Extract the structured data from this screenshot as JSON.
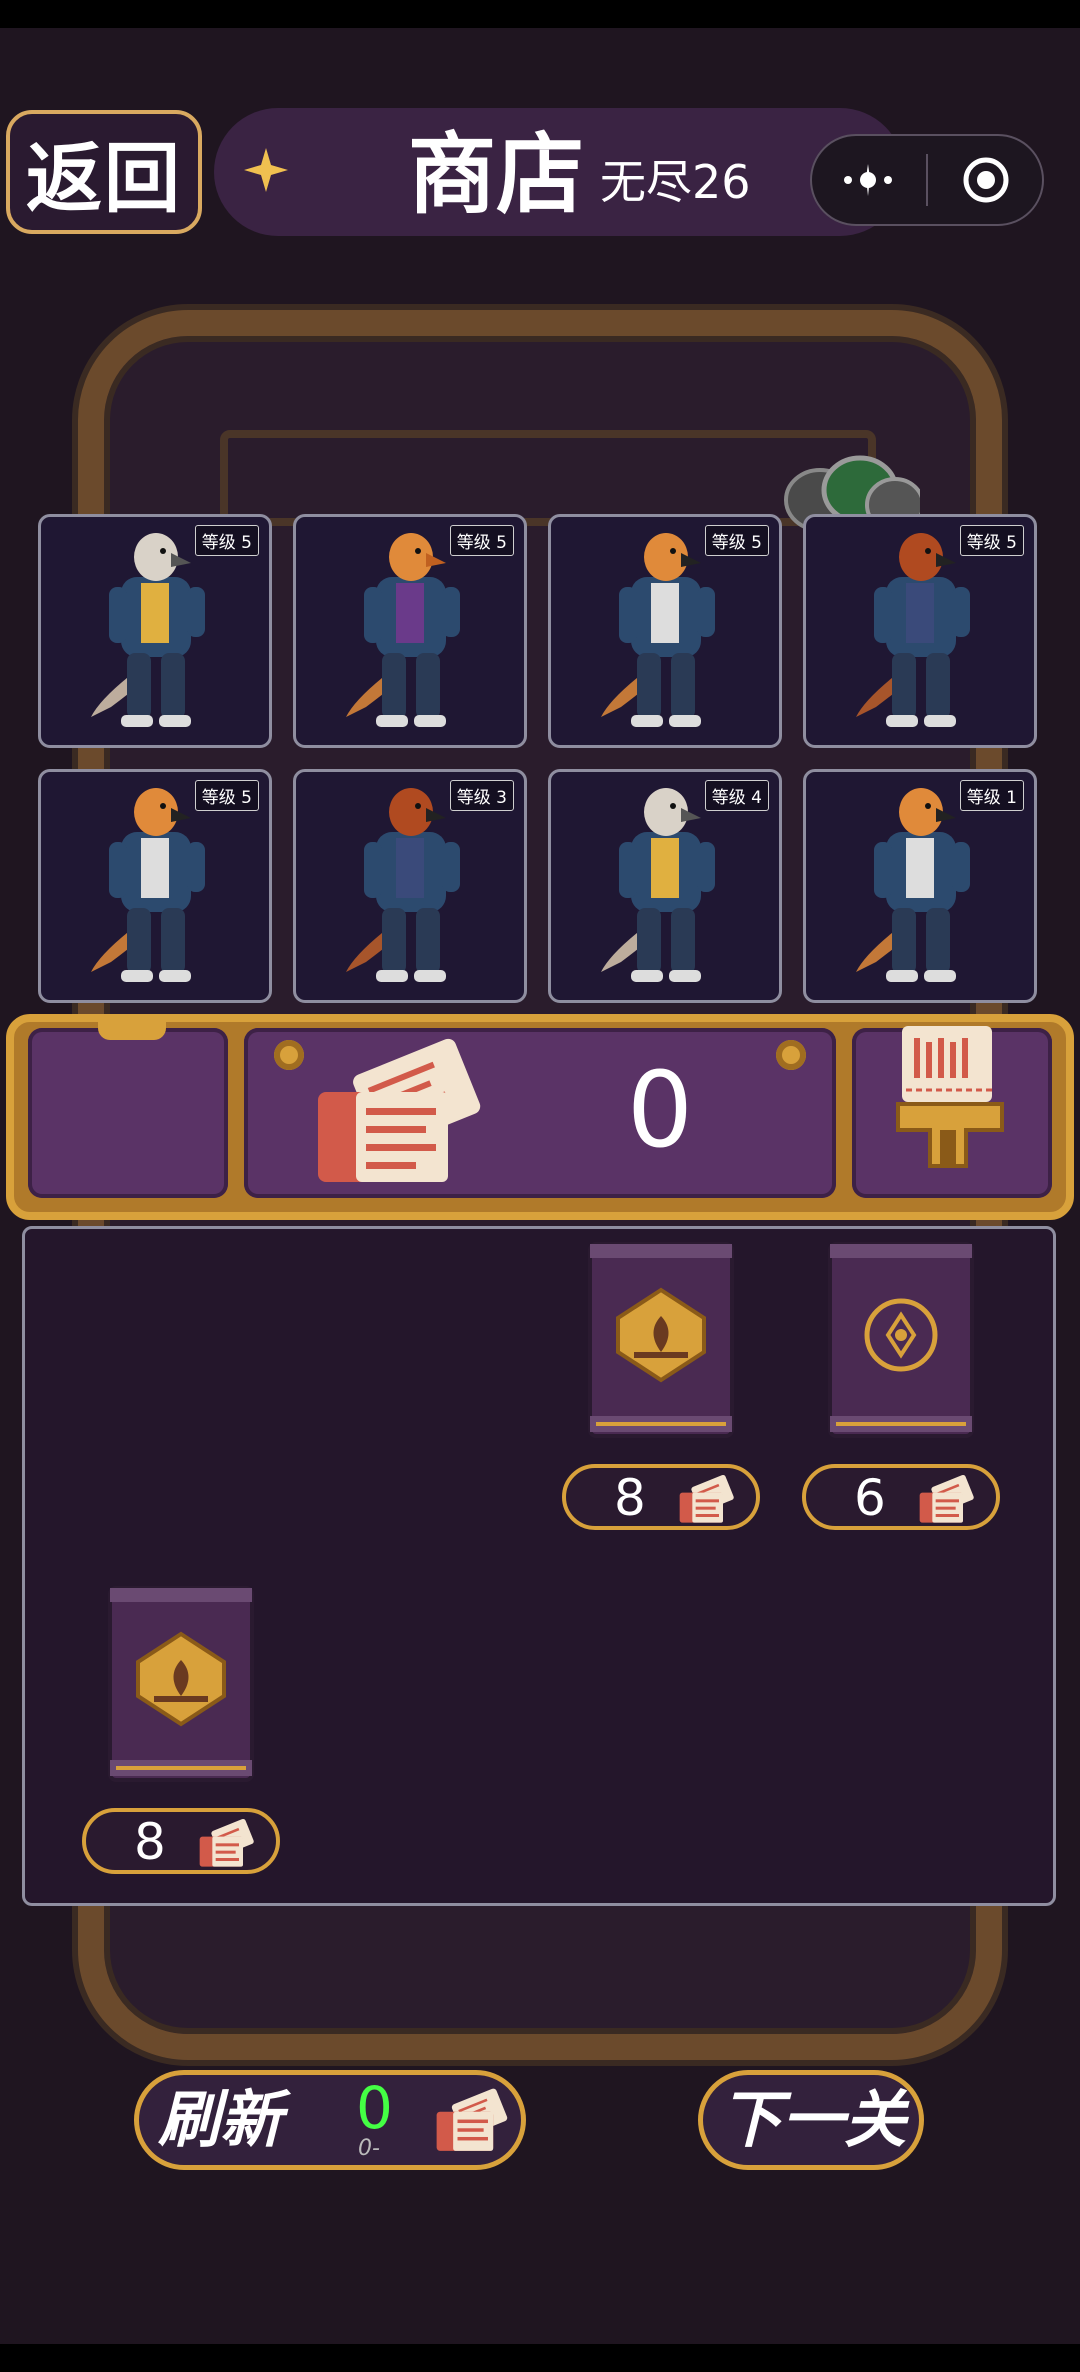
{
  "header": {
    "back_label": "返回",
    "title": "商店",
    "subtitle": "无尽26"
  },
  "team": [
    {
      "level": "等级 5",
      "character": "bird"
    },
    {
      "level": "等级 5",
      "character": "lizard"
    },
    {
      "level": "等级 5",
      "character": "tiger"
    },
    {
      "level": "等级 5",
      "character": "ant"
    },
    {
      "level": "等级 5",
      "character": "tiger"
    },
    {
      "level": "等级 3",
      "character": "ant"
    },
    {
      "level": "等级 4",
      "character": "bird"
    },
    {
      "level": "等级 1",
      "character": "tiger"
    }
  ],
  "tickets": {
    "count": "0"
  },
  "shop": {
    "items": [
      {
        "price": "8",
        "emblem": "ornate"
      },
      {
        "price": "6",
        "emblem": "round"
      },
      {
        "price": "8",
        "emblem": "ornate"
      }
    ]
  },
  "footer": {
    "refresh_label": "刷新",
    "refresh_cost": "0",
    "refresh_sub": "0-",
    "next_label": "下一关"
  },
  "colors": {
    "background": "#1f1520",
    "gold": "#d8a13b",
    "panel_purple": "#5a3366",
    "free_cost_green": "#44ff44"
  }
}
